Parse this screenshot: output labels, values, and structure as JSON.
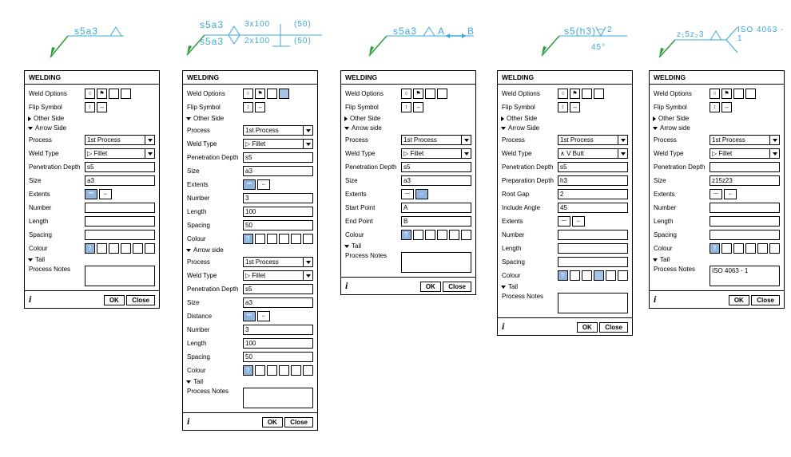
{
  "symbols": {
    "s1": "s5a3",
    "s2_top": "s5a3",
    "s2_bot": "s5a3",
    "s2_top_dim": "3x100",
    "s2_bot_dim": "2x100",
    "s2_top_sp": "(50)",
    "s2_bot_sp": "(50)",
    "s3_text": "s5a3",
    "s3_a": "A",
    "s3_b": "B",
    "s4": "s5(h3)",
    "s4_angle": "45°",
    "s4_gap": "2",
    "s5_size": "z₁5z₂3",
    "s5_tail": "ISO 4063 - 1"
  },
  "labels": {
    "panel_title": "WELDING",
    "weld_options": "Weld Options",
    "flip_symbol": "Flip Symbol",
    "other_side": "Other Side",
    "arrow_side": "Arrow Side",
    "arrow_side_lc": "Arrow side",
    "process": "Process",
    "weld_type": "Weld Type",
    "pen_depth": "Penetration Depth",
    "prep_depth": "Preparation Depth",
    "root_gap": "Root Gap",
    "include_angle": "Include Angle",
    "size": "Size",
    "extents": "Extents",
    "number": "Number",
    "length": "Length",
    "spacing": "Spacing",
    "colour": "Colour",
    "tail": "Tail",
    "process_notes": "Process Notes",
    "start_point": "Start Point",
    "end_point": "End Point",
    "distance": "Distance",
    "ok": "OK",
    "close": "Close"
  },
  "values": {
    "process_1st": "1st Process",
    "weld_fillet": "▷ Fillet",
    "weld_vbutt": "∧ V Butt",
    "p1_pen": "s5",
    "p1_size": "a3",
    "p2_pen": "s5",
    "p2_size": "a3",
    "p2_number": "3",
    "p2_length": "100",
    "p2_spacing": "50",
    "p3_pen": "s5",
    "p3_size": "a3",
    "p3_sp": "A",
    "p3_ep": "B",
    "p4_pen": "s5",
    "p4_prep": "h3",
    "p4_root": "2",
    "p4_angle": "45",
    "p5_size": "z15z23",
    "p5_notes": "ISO 4063 - 1"
  },
  "icons": {
    "flag": "⚑",
    "flip_v": "↕",
    "flip_h": "↔",
    "question": "?",
    "info": "i"
  }
}
